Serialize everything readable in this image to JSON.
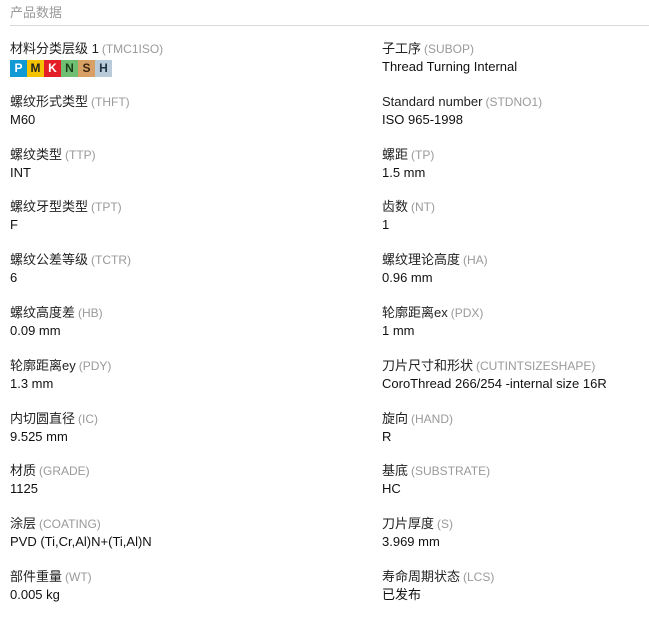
{
  "header": {
    "title": "产品数据"
  },
  "iso_groups": [
    {
      "letter": "P",
      "color": "#0f9ad6"
    },
    {
      "letter": "M",
      "color": "#f4c200"
    },
    {
      "letter": "K",
      "color": "#e41e26"
    },
    {
      "letter": "N",
      "color": "#6fbf73"
    },
    {
      "letter": "S",
      "color": "#d9a066"
    },
    {
      "letter": "H",
      "color": "#b9cbd8"
    }
  ],
  "rows": [
    {
      "left": {
        "label": "材料分类层级 1",
        "code": "(TMC1ISO)",
        "value": ""
      },
      "right": {
        "label": "子工序",
        "code": "(SUBOP)",
        "value": "Thread Turning Internal"
      }
    },
    {
      "left": {
        "label": "螺纹形式类型",
        "code": "(THFT)",
        "value": "M60"
      },
      "right": {
        "label": "Standard number",
        "code": "(STDNO1)",
        "value": "ISO 965-1998"
      }
    },
    {
      "left": {
        "label": "螺纹类型",
        "code": "(TTP)",
        "value": "INT"
      },
      "right": {
        "label": "螺距",
        "code": "(TP)",
        "value": "1.5 mm"
      }
    },
    {
      "left": {
        "label": "螺纹牙型类型",
        "code": "(TPT)",
        "value": "F"
      },
      "right": {
        "label": "齿数",
        "code": "(NT)",
        "value": "1"
      }
    },
    {
      "left": {
        "label": "螺纹公差等级",
        "code": "(TCTR)",
        "value": "6"
      },
      "right": {
        "label": "螺纹理论高度",
        "code": "(HA)",
        "value": "0.96 mm"
      }
    },
    {
      "left": {
        "label": "螺纹高度差",
        "code": "(HB)",
        "value": "0.09 mm"
      },
      "right": {
        "label": "轮廓距离ex",
        "code": "(PDX)",
        "value": "1 mm"
      }
    },
    {
      "left": {
        "label": "轮廓距离ey",
        "code": "(PDY)",
        "value": "1.3 mm"
      },
      "right": {
        "label": "刀片尺寸和形状",
        "code": "(CUTINTSIZESHAPE)",
        "value": "CoroThread 266/254 -internal size 16R"
      }
    },
    {
      "left": {
        "label": "内切圆直径",
        "code": "(IC)",
        "value": "9.525 mm"
      },
      "right": {
        "label": "旋向",
        "code": "(HAND)",
        "value": "R"
      }
    },
    {
      "left": {
        "label": "材质",
        "code": "(GRADE)",
        "value": "1125"
      },
      "right": {
        "label": "基底",
        "code": "(SUBSTRATE)",
        "value": "HC"
      }
    },
    {
      "left": {
        "label": "涂层",
        "code": "(COATING)",
        "value": "PVD (Ti,Cr,Al)N+(Ti,Al)N"
      },
      "right": {
        "label": "刀片厚度",
        "code": "(S)",
        "value": "3.969 mm"
      }
    },
    {
      "left": {
        "label": "部件重量",
        "code": "(WT)",
        "value": "0.005 kg"
      },
      "right": {
        "label": "寿命周期状态",
        "code": "(LCS)",
        "value": "已发布"
      }
    }
  ]
}
